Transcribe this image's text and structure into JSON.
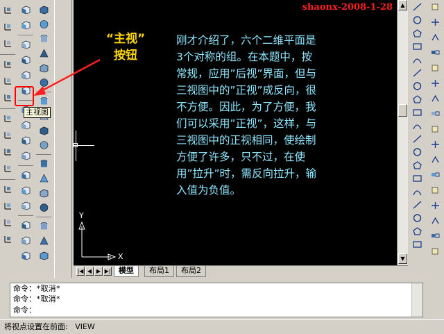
{
  "watermark": "shaonx-2008-1-28",
  "callout": {
    "line1": "“主视”",
    "line2": "按钮"
  },
  "tooltip": "主视图",
  "paragraph": [
    "刚才介绍了，六个二维平面是",
    "3个对称的组。在本题中，按",
    "常规，应用”后视”界面，但与",
    "三视图中的”正视”成反向，很",
    "不方便。因此，为了方便，我",
    "们可以采用”正视”，这样，与",
    "三视图中的正视相同，使绘制",
    "方便了许多，只不过，在使",
    "用”拉升”时，需反向拉升，输",
    "入值为负值。"
  ],
  "ucs": {
    "y_label": "Y",
    "x_label": "X"
  },
  "layout_tabs": [
    "模型",
    "布局1",
    "布局2"
  ],
  "active_tab": "模型",
  "nav_buttons": [
    "|◀",
    "◀",
    "▶",
    "▶|"
  ],
  "command_lines": [
    "命令：*取消*",
    "命令：*取消*",
    "命令："
  ],
  "status_text": "将视点设置在前面:   VIEW",
  "colors": {
    "text": "#8fe8ff",
    "callout": "#ffd700",
    "watermark": "#ff2020",
    "arrow": "#ff2020",
    "highlight": "#ff0000"
  },
  "icons": {
    "col1": [
      "ucs-icon",
      "ucs-world-icon",
      "ucs-origin-icon",
      "ucs-3point-icon",
      "ucs-x-icon",
      "ucs-y-icon",
      "ucs-z-icon",
      "ucs-z-axis-icon",
      "ucs-view-icon",
      "ucs-face-icon",
      "ucs-apply-icon",
      "ucs-named-icon",
      "ucs-previous-icon",
      "ucs-object-icon"
    ],
    "col2": [
      "top-view-icon",
      "bottom-view-icon",
      "left-view-icon",
      "right-view-icon",
      "front-view-icon",
      "back-view-icon",
      "sw-iso-icon",
      "se-iso-icon",
      "ne-iso-icon",
      "nw-iso-icon",
      "camera-icon",
      "cylinder-solid-icon",
      "cone-solid-icon",
      "pyramid-icon",
      "wedge-icon",
      "torus-icon"
    ],
    "col3": [
      "box-solid-icon",
      "sphere-icon",
      "cylinder-icon",
      "cone-icon",
      "wedge-solid-icon",
      "torus-solid-icon",
      "extrude-icon",
      "revolve-icon",
      "slice-icon",
      "section-icon",
      "interfere-icon",
      "setup-drawing-icon",
      "setup-view-icon",
      "setup-profile-icon",
      "union-icon",
      "subtract-icon",
      "intersect-icon"
    ],
    "draw": [
      "line-icon",
      "construction-line-icon",
      "polyline-icon",
      "polygon-icon",
      "rectangle-icon",
      "arc-icon",
      "circle-icon",
      "revision-cloud-icon",
      "spline-icon",
      "ellipse-icon",
      "ellipse-arc-icon",
      "insert-block-icon",
      "make-block-icon",
      "point-icon",
      "hatch-icon",
      "gradient-icon",
      "region-icon",
      "table-icon",
      "multiline-text-icon"
    ],
    "modify": [
      "erase-icon",
      "copy-icon",
      "mirror-icon",
      "offset-icon",
      "array-icon",
      "move-icon",
      "rotate-icon",
      "scale-icon",
      "stretch-icon",
      "trim-icon",
      "extend-icon",
      "break-point-icon",
      "break-icon",
      "join-icon",
      "chamfer-icon",
      "fillet-icon",
      "explode-icon"
    ]
  }
}
